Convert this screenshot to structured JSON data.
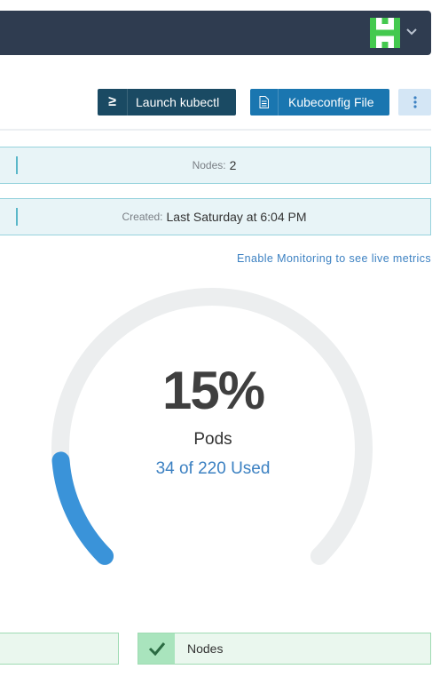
{
  "header": {
    "avatar_icon": "user-avatar-identicon",
    "menu_icon": "chevron-down-icon"
  },
  "toolbar": {
    "kubectl_icon": "terminal-prompt-icon",
    "kubectl_glyph": "≥",
    "kubectl_label": "Launch kubectl",
    "kubeconfig_icon": "file-icon",
    "kubeconfig_label": "Kubeconfig File",
    "more_icon": "vertical-dots-icon"
  },
  "info": {
    "nodes_key": "Nodes:",
    "nodes_value": "2",
    "created_key": "Created:",
    "created_value": "Last Saturday at 6:04 PM"
  },
  "monitoring_link": "Enable Monitoring to see live metrics",
  "gauge": {
    "percent_text": "15%",
    "percent": 15,
    "label": "Pods",
    "used_text": "34 of 220 Used",
    "used": 34,
    "total": 220
  },
  "status_cards": {
    "nodes_label": "Nodes",
    "nodes_icon": "checkmark-icon"
  },
  "colors": {
    "topbar": "#2f3c50",
    "accent_blue": "#3c81c2",
    "gauge_fill": "#3a93d9",
    "gauge_track": "#eceeef",
    "success_green": "#a9e4bd"
  }
}
